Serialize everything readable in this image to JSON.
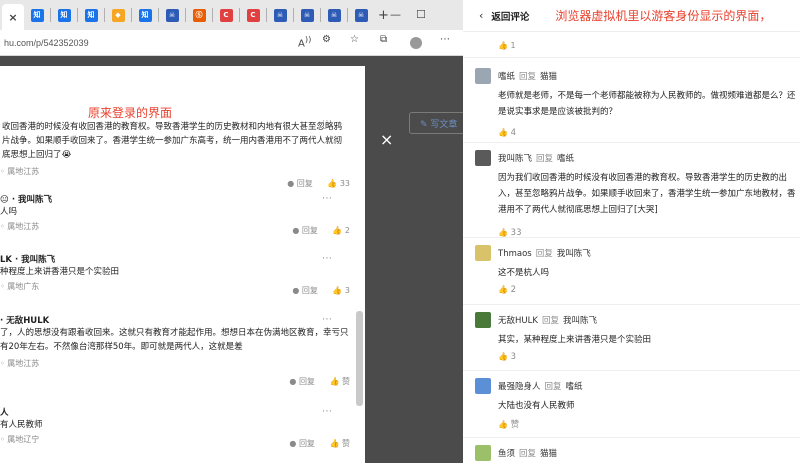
{
  "left": {
    "tabs": [
      {
        "icon": "×",
        "color": "#444"
      },
      {
        "icon": "知",
        "color": "#1a73e8"
      },
      {
        "icon": "知",
        "color": "#1a73e8"
      },
      {
        "icon": "知",
        "color": "#1a73e8"
      },
      {
        "icon": "◆",
        "color": "#f5a623"
      },
      {
        "icon": "知",
        "color": "#1a73e8"
      },
      {
        "icon": "☠",
        "color": "#2d5bb5"
      },
      {
        "icon": "Ⓢ",
        "color": "#e85d04"
      },
      {
        "icon": "C",
        "color": "#e04040"
      },
      {
        "icon": "C",
        "color": "#e04040"
      },
      {
        "icon": "☠",
        "color": "#2d5bb5"
      },
      {
        "icon": "☠",
        "color": "#2d5bb5"
      },
      {
        "icon": "☠",
        "color": "#2d5bb5"
      },
      {
        "icon": "☠",
        "color": "#2d5bb5"
      }
    ],
    "new_tab": "+",
    "url": "hu.com/p/542352039",
    "window_controls": {
      "min": "—",
      "max": "☐"
    },
    "write_label": "写文章",
    "label": "原来登录的界面",
    "close": "×",
    "comments": [
      {
        "name": "",
        "text": "收回香港的时候没有收回香港的教育权。导致香港学生的历史教材和内地有很大甚至忽略鸦片战争。如果顺手收回来了。香港学生统一参加广东高考，统一用内香港用不了两代人就彻底思想上回归了😭",
        "meta": "属地江苏",
        "reply": "回复",
        "likes": "33"
      },
      {
        "name": "😐 · 我叫陈飞",
        "text": "人吗",
        "meta": "属地江苏",
        "reply": "回复",
        "likes": "2"
      },
      {
        "name": "LK · 我叫陈飞",
        "text": "种程度上来讲香港只是个实验田",
        "meta": "属地广东",
        "reply": "回复",
        "likes": "3"
      },
      {
        "name": "· 无敌HULK",
        "text": "了，人的思想没有跟着收回来。这就只有教育才能起作用。想想日本在伪满地区教育，幸亏只有20年左右。不然像台湾那样50年。即可就是两代人，这就是差",
        "meta": "属地江苏",
        "reply": "回复",
        "likes": "赞"
      },
      {
        "name": "人",
        "text": "有人民教师",
        "meta": "属地辽宁",
        "reply": "回复",
        "likes": "赞"
      }
    ]
  },
  "right": {
    "back": "‹",
    "title": "返回评论",
    "note": "浏览器虚拟机里以游客身份显示的界面，",
    "comments": [
      {
        "name": "嗜纸",
        "reply_to": "猫猫",
        "reply": "回复",
        "text": "老师就是老师，不是每一个老师都能被称为人民教师的。做视频难道都是么？还是说实事求是是应该被批判的？",
        "likes": "4",
        "avatar": "#9aa6b2"
      },
      {
        "name": "我叫陈飞",
        "reply_to": "嗜纸",
        "reply": "回复",
        "text": "因为我们收回香港的时候没有收回香港的教育权。导致香港学生的历史教的出入，甚至忽略鸦片战争。如果顺手收回来了，香港学生统一参加广东地教材，香港用不了两代人就彻底思想上回归了[大哭]",
        "likes": "33",
        "avatar": "#5a5a5a"
      },
      {
        "name": "Thmaos",
        "reply_to": "我叫陈飞",
        "reply": "回复",
        "text": "这不是杭人吗",
        "likes": "2",
        "avatar": "#d8c36a"
      },
      {
        "name": "无敌HULK",
        "reply_to": "我叫陈飞",
        "reply": "回复",
        "text": "其实，某种程度上来讲香港只是个实验田",
        "likes": "3",
        "avatar": "#4a7a3a"
      },
      {
        "name": "最强隐身人",
        "reply_to": "嗜纸",
        "reply": "回复",
        "text": "大陆也没有人民教师",
        "likes": "赞",
        "avatar": "#5b8fd6"
      },
      {
        "name": "鱼须",
        "reply_to": "猫猫",
        "reply": "回复",
        "text": "",
        "likes": "",
        "avatar": "#9cc06a"
      }
    ],
    "top_likes": "1"
  }
}
